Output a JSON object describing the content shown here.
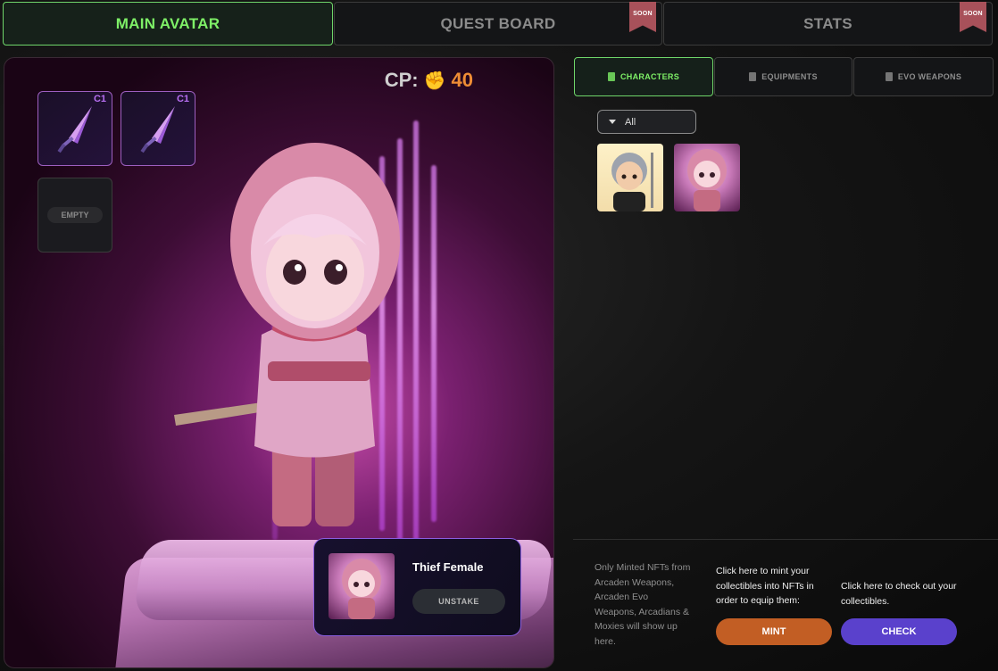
{
  "top_tabs": [
    {
      "label": "MAIN AVATAR",
      "active": true
    },
    {
      "label": "QUEST BOARD",
      "badge": "SOON"
    },
    {
      "label": "STATS",
      "badge": "SOON"
    }
  ],
  "avatar": {
    "cp_label": "CP:",
    "cp_value": "40",
    "slots": [
      {
        "tier": "C1",
        "item": "sword-icon"
      },
      {
        "tier": "C1",
        "item": "sword-icon"
      },
      {
        "empty_label": "EMPTY"
      }
    ],
    "character_card": {
      "name": "Thief Female",
      "unstake_label": "UNSTAKE"
    }
  },
  "inventory": {
    "tabs": [
      {
        "label": "CHARACTERS",
        "active": true
      },
      {
        "label": "EQUIPMENTS"
      },
      {
        "label": "EVO WEAPONS"
      }
    ],
    "filter_value": "All",
    "items": [
      {
        "name": "silver-haired-character"
      },
      {
        "name": "thief-female"
      }
    ]
  },
  "footer": {
    "info": "Only Minted NFTs from Arcaden Weapons, Arcaden Evo Weapons, Arcadians & Moxies will show up here.",
    "mint_text": "Click here to mint your collectibles into NFTs in order to equip them:",
    "mint_label": "MINT",
    "check_text": "Click here to check out your collectibles.",
    "check_label": "CHECK"
  },
  "colors": {
    "accent_green": "#7ef067",
    "mint": "#c25e24",
    "check": "#5a41cc",
    "cp_orange": "#ee8d35",
    "soon_badge": "#a8515a"
  }
}
